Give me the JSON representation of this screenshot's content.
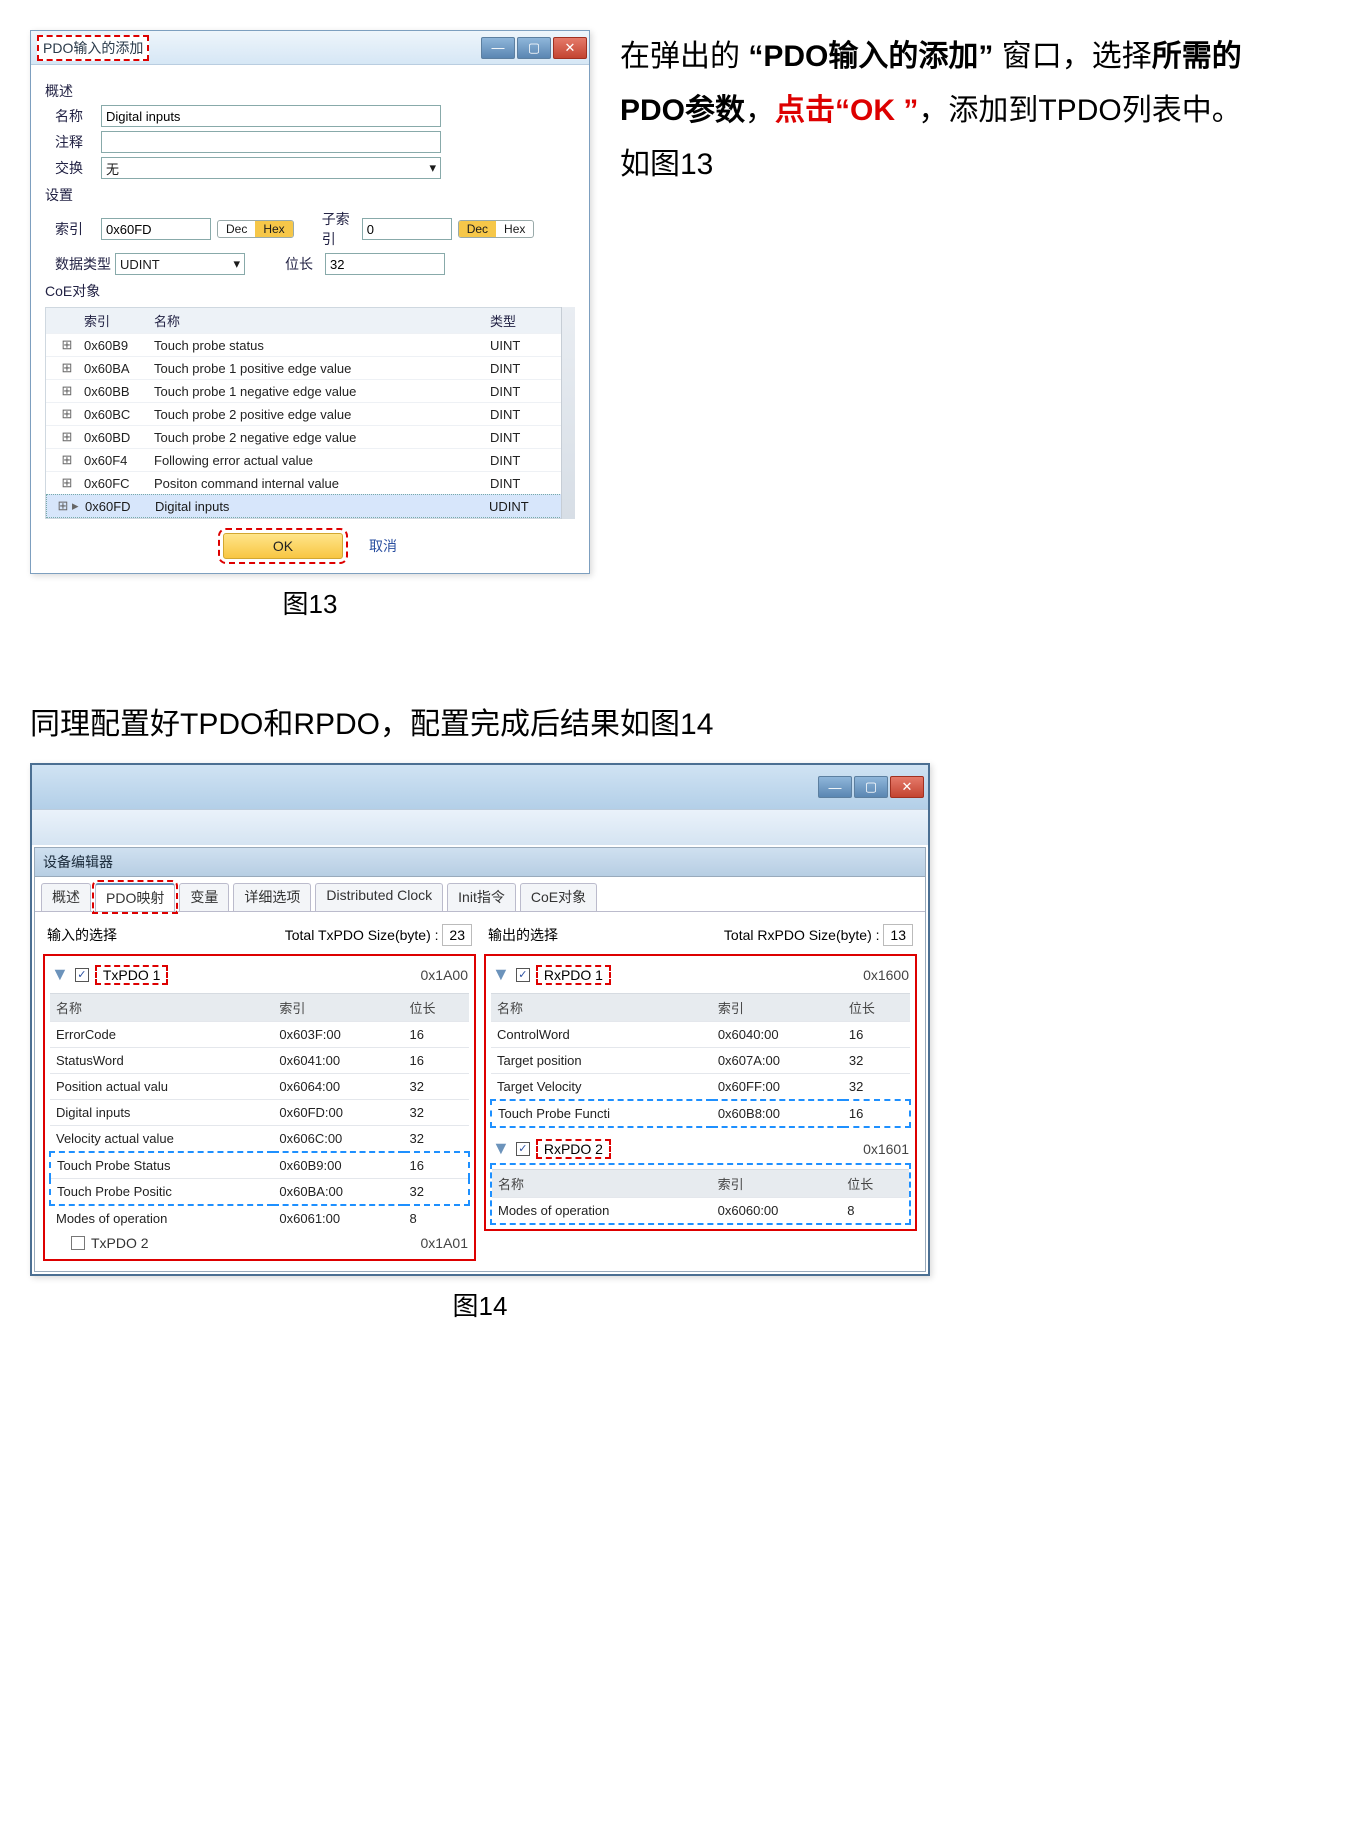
{
  "fig13": {
    "dialog_title": "PDO输入的添加",
    "section_desc": "概述",
    "rows": {
      "name_label": "名称",
      "name_value": "Digital inputs",
      "comment_label": "注释",
      "exchange_label": "交换",
      "exchange_value": "无"
    },
    "section_set": "设置",
    "set": {
      "index_label": "索引",
      "index_value": "0x60FD",
      "subindex_label": "子索引",
      "subindex_value": "0",
      "dtype_label": "数据类型",
      "dtype_value": "UDINT",
      "bitlen_label": "位长",
      "bitlen_value": "32"
    },
    "dec": "Dec",
    "hex": "Hex",
    "section_coe": "CoE对象",
    "coe_head": {
      "idx": "索引",
      "name": "名称",
      "type": "类型"
    },
    "coe_rows": [
      {
        "idx": "0x60B9",
        "name": "Touch probe status",
        "type": "UINT"
      },
      {
        "idx": "0x60BA",
        "name": "Touch probe 1 positive edge value",
        "type": "DINT"
      },
      {
        "idx": "0x60BB",
        "name": "Touch probe 1 negative edge value",
        "type": "DINT"
      },
      {
        "idx": "0x60BC",
        "name": "Touch probe 2 positive edge value",
        "type": "DINT"
      },
      {
        "idx": "0x60BD",
        "name": "Touch probe 2 negative edge value",
        "type": "DINT"
      },
      {
        "idx": "0x60F4",
        "name": "Following error actual value",
        "type": "DINT"
      },
      {
        "idx": "0x60FC",
        "name": "Positon command internal value",
        "type": "DINT"
      }
    ],
    "coe_selected": {
      "idx": "0x60FD",
      "name": "Digital inputs",
      "type": "UDINT"
    },
    "ok": "OK",
    "cancel": "取消",
    "caption": "图13"
  },
  "side": {
    "t1a": "在弹出的 ",
    "t1b": "“PDO输入的添加”",
    "t1c": " 窗口，选择",
    "t1d": "所需的PDO参数",
    "t1e": "，",
    "t1f": "点击“OK ”",
    "t1g": "，添加到TPDO列表中。",
    "t2": "如图13"
  },
  "para14": "同理配置好TPDO和RPDO，配置完成后结果如图14",
  "fig14": {
    "editor_title": "设备编辑器",
    "tabs": [
      "概述",
      "PDO映射",
      "变量",
      "详细选项",
      "Distributed Clock",
      "Init指令",
      "CoE对象"
    ],
    "left": {
      "label": "输入的选择",
      "size_label": "Total TxPDO Size(byte) :",
      "size_value": "23",
      "pdo1": {
        "name": "TxPDO 1",
        "id": "0x1A00",
        "cols": {
          "name": "名称",
          "idx": "索引",
          "bit": "位长"
        },
        "rows": [
          {
            "name": "ErrorCode",
            "idx": "0x603F:00",
            "bit": "16"
          },
          {
            "name": "StatusWord",
            "idx": "0x6041:00",
            "bit": "16"
          },
          {
            "name": "Position actual valu",
            "idx": "0x6064:00",
            "bit": "32"
          },
          {
            "name": "Digital inputs",
            "idx": "0x60FD:00",
            "bit": "32"
          },
          {
            "name": "Velocity actual value",
            "idx": "0x606C:00",
            "bit": "32"
          }
        ],
        "blue_rows": [
          {
            "name": "Touch Probe Status",
            "idx": "0x60B9:00",
            "bit": "16"
          },
          {
            "name": "Touch Probe Positic",
            "idx": "0x60BA:00",
            "bit": "32"
          }
        ],
        "last_row": {
          "name": "Modes of operation",
          "idx": "0x6061:00",
          "bit": "8"
        }
      },
      "pdo2": {
        "name": "TxPDO 2",
        "id": "0x1A01"
      }
    },
    "right": {
      "label": "输出的选择",
      "size_label": "Total RxPDO Size(byte) :",
      "size_value": "13",
      "pdo1": {
        "name": "RxPDO 1",
        "id": "0x1600",
        "cols": {
          "name": "名称",
          "idx": "索引",
          "bit": "位长"
        },
        "rows": [
          {
            "name": "ControlWord",
            "idx": "0x6040:00",
            "bit": "16"
          },
          {
            "name": "Target position",
            "idx": "0x607A:00",
            "bit": "32"
          },
          {
            "name": "Target Velocity",
            "idx": "0x60FF:00",
            "bit": "32"
          }
        ],
        "blue_row": {
          "name": "Touch Probe Functi",
          "idx": "0x60B8:00",
          "bit": "16"
        }
      },
      "pdo2": {
        "name": "RxPDO 2",
        "id": "0x1601",
        "cols": {
          "name": "名称",
          "idx": "索引",
          "bit": "位长"
        },
        "row": {
          "name": "Modes of operation",
          "idx": "0x6060:00",
          "bit": "8"
        }
      }
    },
    "caption": "图14"
  },
  "winbtn": {
    "min": "—",
    "max": "▢",
    "close": "✕"
  }
}
